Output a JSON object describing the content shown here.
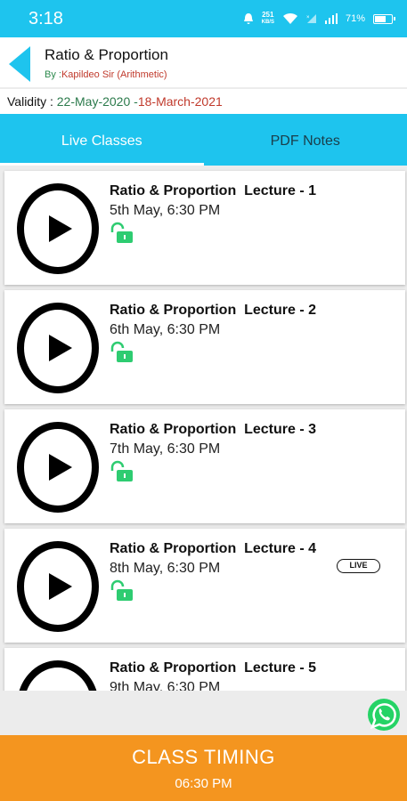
{
  "status_bar": {
    "time": "3:18",
    "speed_value": "251",
    "speed_unit": "KB/S",
    "battery": "71%",
    "battery_level": 0.71
  },
  "header": {
    "title": "Ratio & Proportion",
    "by_prefix": "By :",
    "teacher": "Kapildeo Sir (Arithmetic)"
  },
  "validity": {
    "label": "Validity : ",
    "from": "22-May-2020",
    "separator": " -",
    "to": "18-March-2021"
  },
  "tabs": [
    {
      "label": "Live Classes",
      "active": true
    },
    {
      "label": "PDF Notes",
      "active": false
    }
  ],
  "lectures": [
    {
      "title": "Ratio & Proportion  Lecture - 1",
      "date": "5th May, 6:30 PM"
    },
    {
      "title": "Ratio & Proportion  Lecture - 2",
      "date": "6th May, 6:30 PM"
    },
    {
      "title": "Ratio & Proportion  Lecture - 3",
      "date": "7th May, 6:30 PM"
    },
    {
      "title": "Ratio & Proportion  Lecture - 4",
      "date": "8th May, 6:30 PM",
      "badge": "LIVE"
    },
    {
      "title": "Ratio & Proportion  Lecture - 5",
      "date": "9th May, 6:30 PM"
    }
  ],
  "class_timing": {
    "label": "CLASS TIMING",
    "time": "06:30 PM"
  },
  "colors": {
    "accent": "#1ec4ee",
    "orange": "#f4951f",
    "lock_green": "#2ecc71",
    "whatsapp_green": "#25d366"
  }
}
